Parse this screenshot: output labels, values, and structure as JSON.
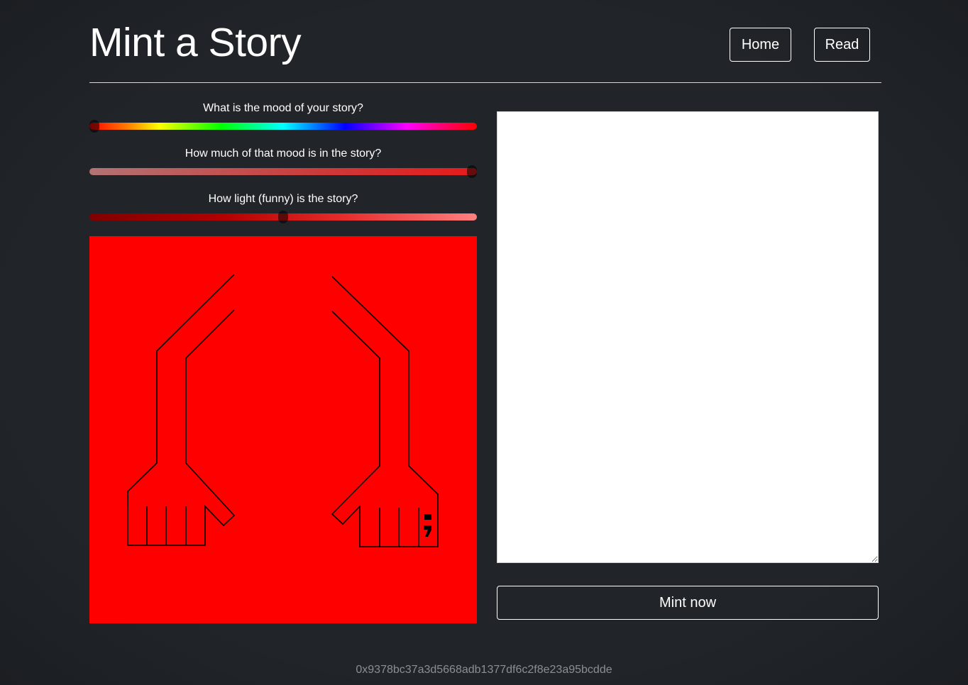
{
  "header": {
    "title": "Mint a Story",
    "nav": {
      "home_label": "Home",
      "read_label": "Read"
    }
  },
  "sliders": [
    {
      "label": "What is the mood of your story?",
      "value_fraction": 0.0,
      "gradient": "hue-spectrum"
    },
    {
      "label": "How much of that mood is in the story?",
      "value_fraction": 1.0,
      "gradient": "red-saturation"
    },
    {
      "label": "How light (funny) is the story?",
      "value_fraction": 0.5,
      "gradient": "red-lightness"
    }
  ],
  "artwork": {
    "background_color": "#ff0000",
    "stroke_color": "#000000",
    "icon": "two-raised-arms-icon"
  },
  "story": {
    "value": "",
    "placeholder": ""
  },
  "mint": {
    "button_label": "Mint now"
  },
  "footer": {
    "wallet_address": "0x9378bc37a3d5668adb1377df6c2f8e23a95bcdde"
  },
  "colors": {
    "background": "#212529",
    "text": "#ffffff",
    "divider": "#d9d9d9",
    "address": "#8a8f94"
  }
}
